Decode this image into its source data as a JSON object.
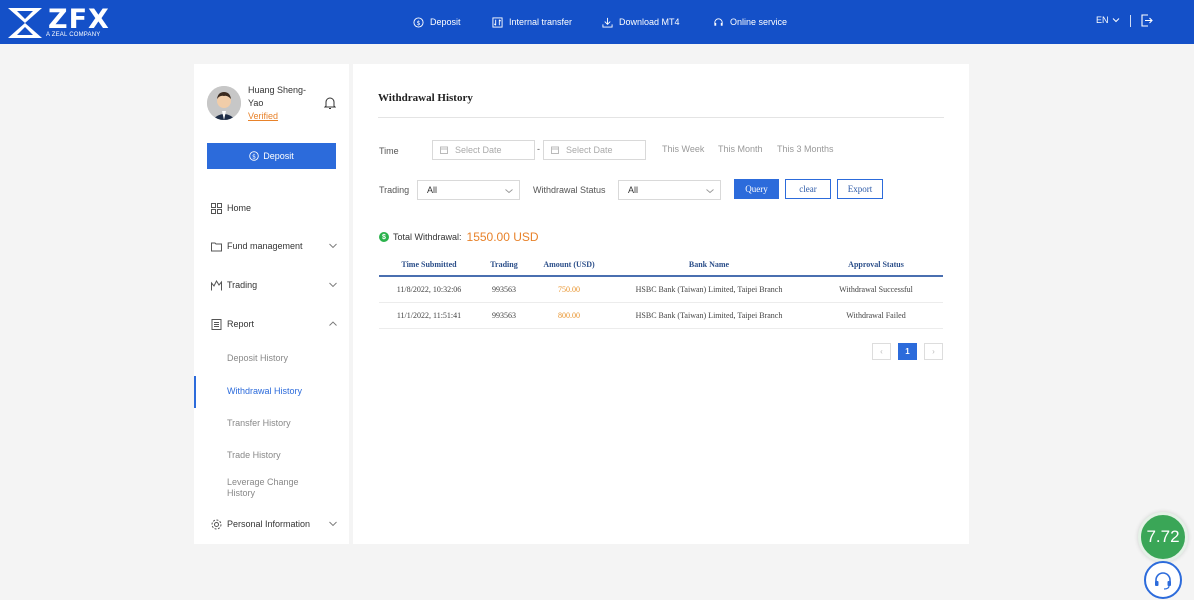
{
  "header": {
    "logo_text": "ZFX",
    "logo_subtitle": "A ZEAL COMPANY",
    "nav": [
      {
        "label": "Deposit",
        "icon": "dollar-circle-icon"
      },
      {
        "label": "Internal transfer",
        "icon": "transfer-icon"
      },
      {
        "label": "Download MT4",
        "icon": "download-icon"
      },
      {
        "label": "Online service",
        "icon": "headset-icon"
      }
    ],
    "language": "EN",
    "colors": {
      "brand": "#1450c8"
    }
  },
  "sidebar": {
    "user_name": "Huang Sheng-Yao",
    "verified_label": "Verified",
    "deposit_label": "Deposit",
    "menu": [
      {
        "label": "Home",
        "icon": "grid-icon"
      },
      {
        "label": "Fund management",
        "icon": "folder-icon"
      },
      {
        "label": "Trading",
        "icon": "chart-icon"
      },
      {
        "label": "Report",
        "icon": "report-icon"
      },
      {
        "label": "Personal Information",
        "icon": "gear-icon"
      }
    ],
    "report_sub": [
      {
        "label": "Deposit History"
      },
      {
        "label": "Withdrawal History",
        "active": true
      },
      {
        "label": "Transfer History"
      },
      {
        "label": "Trade History"
      },
      {
        "label": "Leverage Change History"
      }
    ]
  },
  "main": {
    "title": "Withdrawal History",
    "filters": {
      "time_label": "Time",
      "date_placeholder": "Select Date",
      "date_separator": "-",
      "quick_ranges": [
        "This Week",
        "This Month",
        "This 3 Months"
      ],
      "trading_label": "Trading",
      "trading_value": "All",
      "status_label": "Withdrawal Status",
      "status_value": "All",
      "query_label": "Query",
      "clear_label": "clear",
      "export_label": "Export"
    },
    "total": {
      "icon": "$",
      "label": "Total Withdrawal:",
      "amount": "1550.00 USD"
    },
    "table": {
      "columns": [
        "Time Submitted",
        "Trading",
        "Amount (USD)",
        "Bank Name",
        "Approval Status"
      ],
      "rows": [
        [
          "11/8/2022, 10:32:06",
          "993563",
          "750.00",
          "HSBC Bank (Taiwan) Limited, Taipei Branch",
          "Withdrawal Successful"
        ],
        [
          "11/1/2022, 11:51:41",
          "993563",
          "800.00",
          "HSBC Bank (Taiwan) Limited, Taipei Branch",
          "Withdrawal Failed"
        ]
      ]
    },
    "pagination": {
      "prev": "‹",
      "current": "1",
      "next": "›"
    }
  },
  "widgets": {
    "score": "7.72"
  }
}
